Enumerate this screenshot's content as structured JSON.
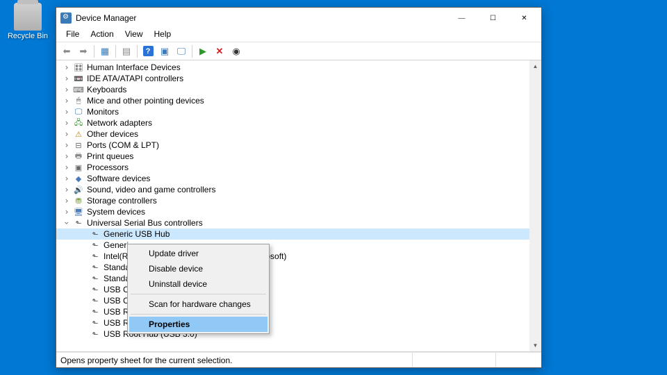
{
  "desktop": {
    "recycle_bin": "Recycle Bin"
  },
  "window": {
    "title": "Device Manager",
    "controls": {
      "min": "—",
      "max": "☐",
      "close": "✕"
    }
  },
  "menubar": [
    "File",
    "Action",
    "View",
    "Help"
  ],
  "toolbar": {
    "back": "⬅",
    "forward": "➡",
    "showhide": "▦",
    "help": "?",
    "refresh": "▣",
    "monitor": "🖵",
    "newdev": "▶",
    "delete": "✕",
    "scan": "◉"
  },
  "tree": {
    "categories": [
      {
        "icon": "🎛",
        "cls": "ic-hid",
        "label": "Human Interface Devices"
      },
      {
        "icon": "📼",
        "cls": "ic-ide",
        "label": "IDE ATA/ATAPI controllers"
      },
      {
        "icon": "⌨",
        "cls": "ic-kbd",
        "label": "Keyboards"
      },
      {
        "icon": "🖱",
        "cls": "ic-mouse",
        "label": "Mice and other pointing devices"
      },
      {
        "icon": "🖵",
        "cls": "ic-mon",
        "label": "Monitors"
      },
      {
        "icon": "🖧",
        "cls": "ic-net",
        "label": "Network adapters"
      },
      {
        "icon": "⚠",
        "cls": "ic-oth",
        "label": "Other devices"
      },
      {
        "icon": "⊟",
        "cls": "ic-port",
        "label": "Ports (COM & LPT)"
      },
      {
        "icon": "🖶",
        "cls": "ic-prn",
        "label": "Print queues"
      },
      {
        "icon": "▣",
        "cls": "ic-cpu",
        "label": "Processors"
      },
      {
        "icon": "◆",
        "cls": "ic-soft",
        "label": "Software devices"
      },
      {
        "icon": "🔊",
        "cls": "ic-snd",
        "label": "Sound, video and game controllers"
      },
      {
        "icon": "⛃",
        "cls": "ic-stor",
        "label": "Storage controllers"
      },
      {
        "icon": "🖥",
        "cls": "ic-sys",
        "label": "System devices"
      }
    ],
    "usb_category": {
      "label": "Universal Serial Bus controllers",
      "icon": "⬑",
      "cls": "ic-usb"
    },
    "usb_children": [
      {
        "label": "Generic USB Hub",
        "selected": true
      },
      {
        "label": "Generi",
        "trunc": true
      },
      {
        "label": "Intel(R)",
        "trunc": true,
        "suffix_visible": "rosoft)"
      },
      {
        "label": "Standa",
        "trunc": true
      },
      {
        "label": "Standa",
        "trunc": true
      },
      {
        "label": "USB Co",
        "trunc": true
      },
      {
        "label": "USB Co",
        "trunc": true
      },
      {
        "label": "USB Ro",
        "trunc": true
      },
      {
        "label": "USB Root Hub"
      },
      {
        "label": "USB Root Hub (USB 3.0)"
      }
    ]
  },
  "context_menu": {
    "items": [
      {
        "label": "Update driver"
      },
      {
        "label": "Disable device"
      },
      {
        "label": "Uninstall device"
      },
      {
        "divider": true
      },
      {
        "label": "Scan for hardware changes"
      },
      {
        "divider": true
      },
      {
        "label": "Properties",
        "highlight": true
      }
    ]
  },
  "statusbar": {
    "text": "Opens property sheet for the current selection."
  }
}
